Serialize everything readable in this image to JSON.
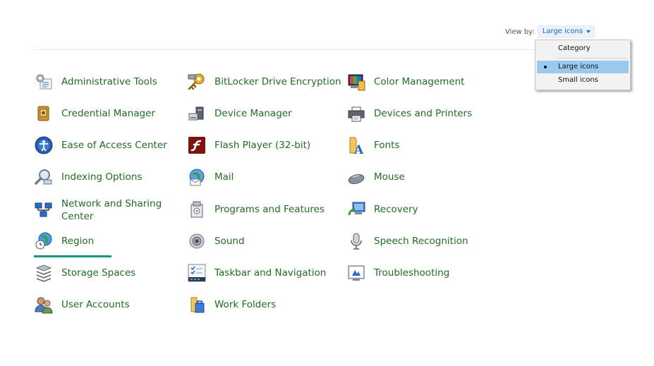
{
  "view_by": {
    "label": "View by:",
    "selected": "Large icons",
    "options": [
      "Category",
      "Large icons",
      "Small icons"
    ]
  },
  "items": [
    {
      "label": "Administrative Tools",
      "icon": "administrative-tools-icon"
    },
    {
      "label": "BitLocker Drive Encryption",
      "icon": "bitlocker-icon"
    },
    {
      "label": "Color Management",
      "icon": "color-management-icon"
    },
    {
      "label": "Credential Manager",
      "icon": "credential-manager-icon"
    },
    {
      "label": "Device Manager",
      "icon": "device-manager-icon"
    },
    {
      "label": "Devices and Printers",
      "icon": "devices-and-printers-icon"
    },
    {
      "label": "Ease of Access Center",
      "icon": "ease-of-access-icon"
    },
    {
      "label": "Flash Player (32-bit)",
      "icon": "flash-player-icon"
    },
    {
      "label": "Fonts",
      "icon": "fonts-icon"
    },
    {
      "label": "Indexing Options",
      "icon": "indexing-options-icon"
    },
    {
      "label": "Mail",
      "icon": "mail-icon"
    },
    {
      "label": "Mouse",
      "icon": "mouse-icon"
    },
    {
      "label": "Network and Sharing Center",
      "icon": "network-sharing-icon"
    },
    {
      "label": "Programs and Features",
      "icon": "programs-features-icon"
    },
    {
      "label": "Recovery",
      "icon": "recovery-icon"
    },
    {
      "label": "Region",
      "icon": "region-icon"
    },
    {
      "label": "Sound",
      "icon": "sound-icon"
    },
    {
      "label": "Speech Recognition",
      "icon": "speech-recognition-icon"
    },
    {
      "label": "Storage Spaces",
      "icon": "storage-spaces-icon"
    },
    {
      "label": "Taskbar and Navigation",
      "icon": "taskbar-navigation-icon"
    },
    {
      "label": "Troubleshooting",
      "icon": "troubleshooting-icon"
    },
    {
      "label": "User Accounts",
      "icon": "user-accounts-icon"
    },
    {
      "label": "Work Folders",
      "icon": "work-folders-icon"
    }
  ],
  "colors": {
    "link_green": "#226c22",
    "link_blue": "#2a62b8",
    "hover_underline": "#14938a",
    "menu_highlight": "#99c9ef"
  }
}
